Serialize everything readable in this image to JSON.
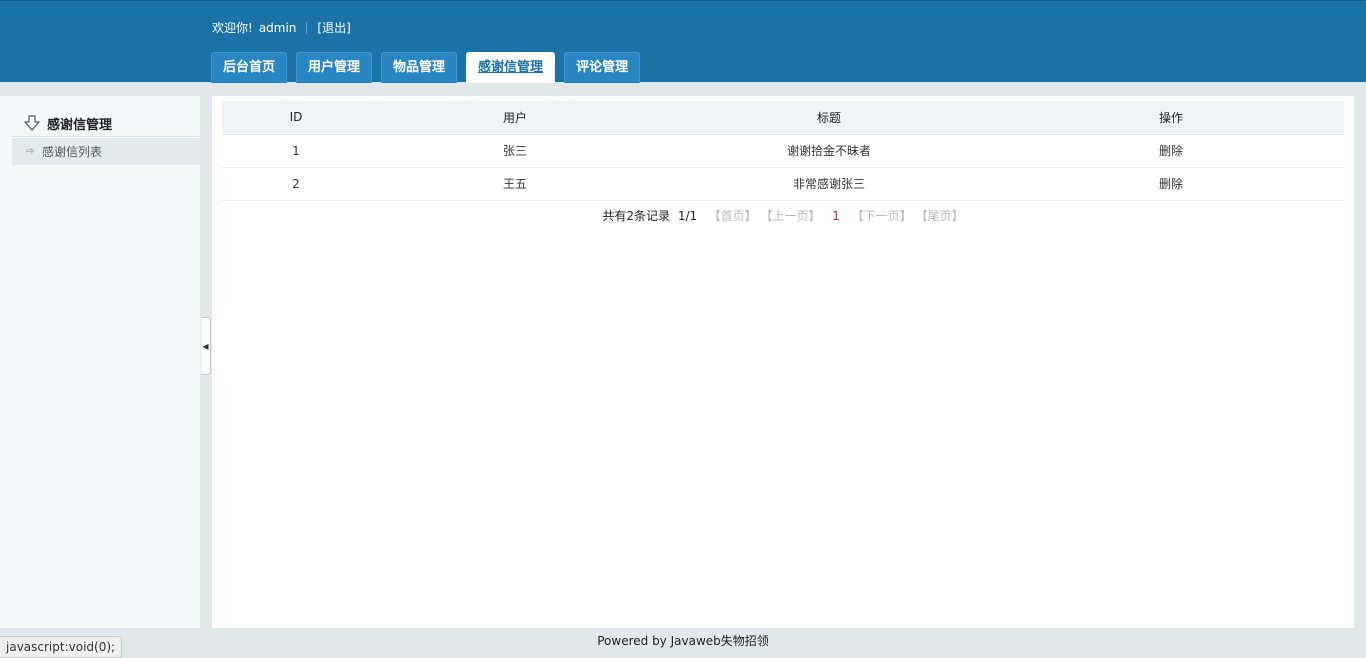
{
  "header": {
    "welcome": "欢迎你!",
    "user": "admin",
    "logout": "[退出]"
  },
  "tabs": [
    {
      "label": "后台首页"
    },
    {
      "label": "用户管理"
    },
    {
      "label": "物品管理"
    },
    {
      "label": "感谢信管理"
    },
    {
      "label": "评论管理"
    }
  ],
  "sidebar": {
    "title": "感谢信管理",
    "icon": "arrow-down-outline-icon",
    "items": [
      {
        "label": "感谢信列表"
      }
    ]
  },
  "table": {
    "headers": [
      "ID",
      "用户",
      "标题",
      "操作"
    ],
    "rows": [
      {
        "id": "1",
        "user": "张三",
        "title": "谢谢拾金不昧者",
        "action": "删除"
      },
      {
        "id": "2",
        "user": "王五",
        "title": "非常感谢张三",
        "action": "删除"
      }
    ]
  },
  "pager": {
    "total": "共有2条记录",
    "pages": "1/1",
    "first": "【首页】",
    "prev": "【上一页】",
    "current": "1",
    "next": "【下一页】",
    "last": "【尾页】"
  },
  "footer": "Powered by Javaweb失物招领",
  "statusbar": "javascript:void(0);"
}
